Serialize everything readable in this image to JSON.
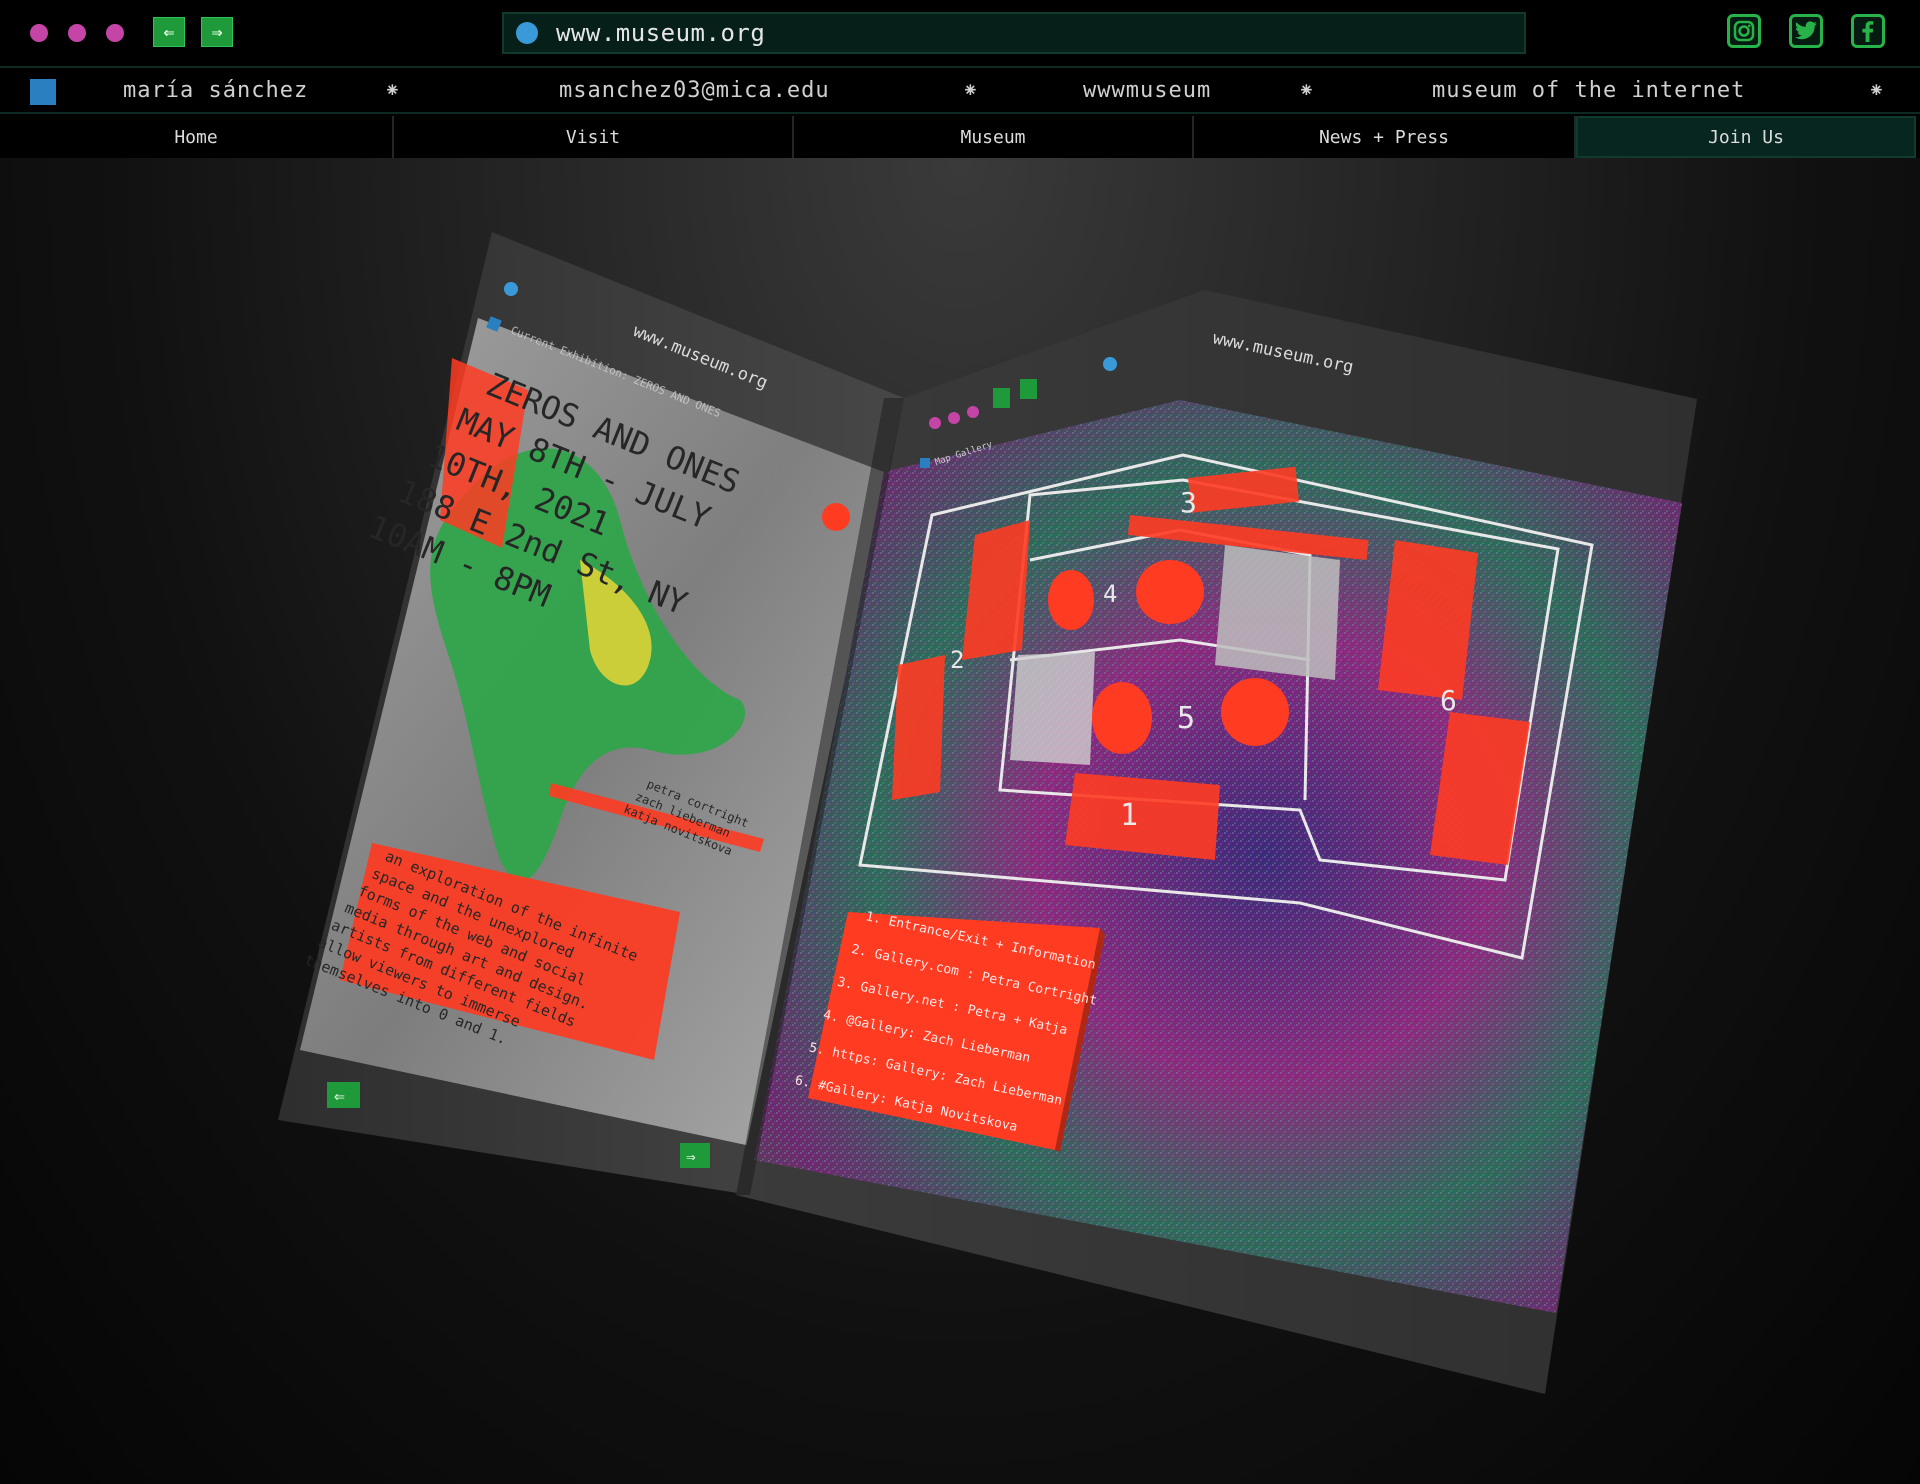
{
  "browser": {
    "window_dots": [
      "#c445a6",
      "#c445a6",
      "#c445a6"
    ],
    "back_icon": "arrow-left-icon",
    "forward_icon": "arrow-right-icon",
    "url": "www.museum.org",
    "globe_color": "#3a9ad9",
    "social": [
      {
        "name": "instagram",
        "icon": "instagram-icon",
        "glyph": "◎"
      },
      {
        "name": "twitter",
        "icon": "twitter-icon",
        "glyph": "🐦"
      },
      {
        "name": "facebook",
        "icon": "facebook-icon",
        "glyph": "f"
      }
    ]
  },
  "marquee": {
    "square_color": "#2a7fc0",
    "items": [
      "maría sánchez",
      "msanchez03@mica.edu",
      "wwwmuseum",
      "museum of the internet"
    ],
    "separator": "⁕"
  },
  "nav": {
    "items": [
      "Home",
      "Visit",
      "Museum",
      "News + Press",
      "Join Us"
    ]
  },
  "brochure": {
    "left_panel": {
      "url": "www.museum.org",
      "breadcrumb": "Current Exhibition: ZEROS AND ONES",
      "headline": [
        "ZEROS AND ONES",
        "MAY 8TH - JULY",
        "10TH, 2021",
        "188 E 2nd St, NY",
        "10AM - 8PM"
      ],
      "artists": [
        "petra cortright",
        "zach lieberman",
        "katja novitskova"
      ],
      "description": [
        "an exploration of the infinite",
        "space and the unexplored",
        "forms of the web and social",
        "media through art and design.",
        "artists from different fields",
        "allow viewers to immerse",
        "themselves into 0 and 1."
      ]
    },
    "right_panel": {
      "url": "www.museum.org",
      "breadcrumb": "Map Gallery",
      "room_numbers": [
        "1",
        "2",
        "3",
        "4",
        "5",
        "6"
      ],
      "legend": [
        "1. Entrance/Exit + Information",
        "2. Gallery.com : Petra Cortright",
        "3. Gallery.net : Petra + Katja",
        "4. @Gallery: Zach Lieberman",
        "5. https: Gallery: Zach Lieberman",
        "6. #Gallery: Katja Novitskova"
      ]
    }
  },
  "colors": {
    "accent_green": "#1f9a3a",
    "accent_red": "#ff3b22",
    "panel_gray": "#3c3c3c",
    "url_bg": "#062019"
  }
}
